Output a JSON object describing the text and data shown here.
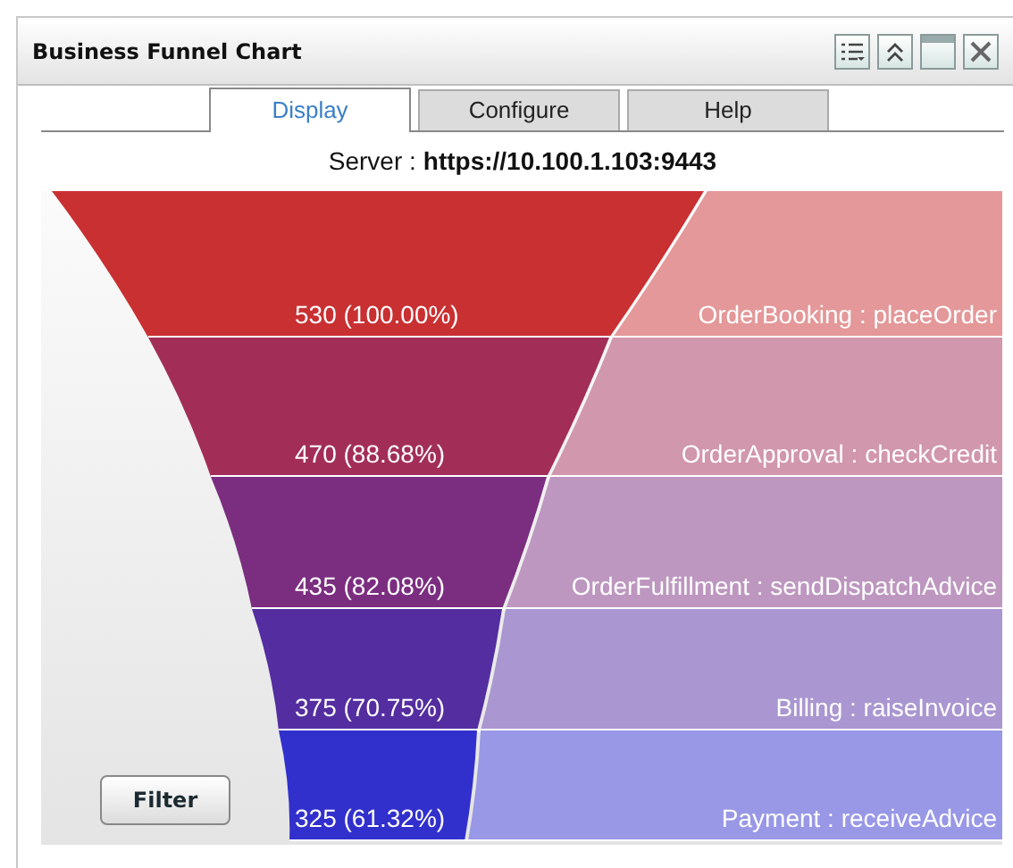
{
  "window": {
    "title": "Business Funnel Chart"
  },
  "tabs": [
    {
      "label": "Display",
      "selected": true
    },
    {
      "label": "Configure",
      "selected": false
    },
    {
      "label": "Help",
      "selected": false
    }
  ],
  "server": {
    "label": "Server :",
    "value": "https://10.100.1.103:9443"
  },
  "funnel": {
    "stages": [
      {
        "value_label": "530 (100.00%)",
        "stage": "OrderBooking : placeOrder",
        "color": "#c93032"
      },
      {
        "value_label": "470 (88.68%)",
        "stage": "OrderApproval : checkCredit",
        "color": "#a22e58"
      },
      {
        "value_label": "435 (82.08%)",
        "stage": "OrderFulfillment : sendDispatchAdvice",
        "color": "#7b2e80"
      },
      {
        "value_label": "375 (70.75%)",
        "stage": "Billing : raiseInvoice",
        "color": "#542da0"
      },
      {
        "value_label": "325 (61.32%)",
        "stage": "Payment : receiveAdvice",
        "color": "#3230cc"
      }
    ]
  },
  "filter_button": {
    "label": "Filter"
  }
}
